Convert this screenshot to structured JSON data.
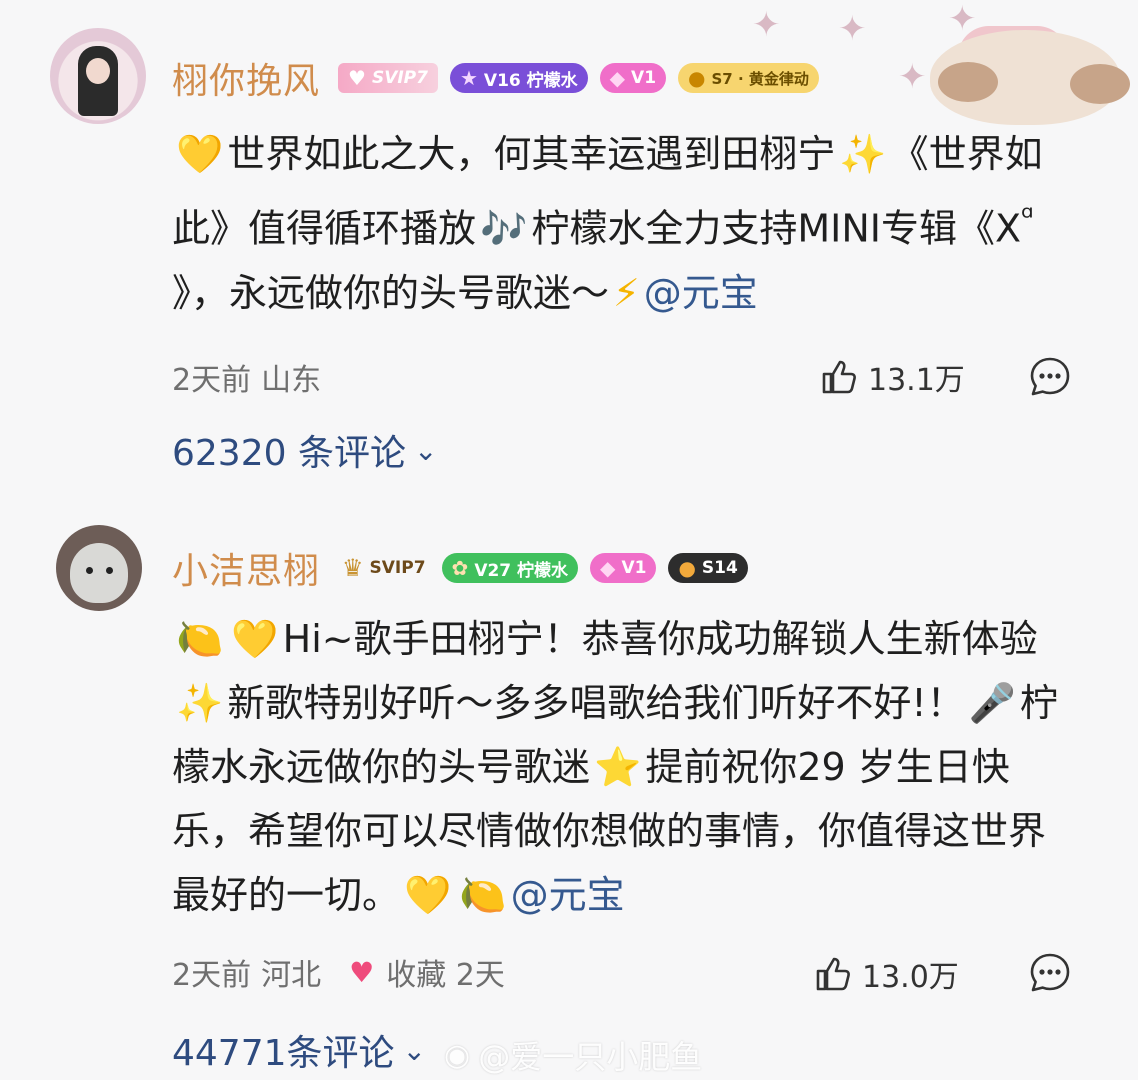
{
  "comments": [
    {
      "username": "栩你挽风",
      "badges": [
        "SVIP7",
        "V16 柠檬水",
        "V1",
        "S7 · 黄金律动"
      ],
      "content_parts": [
        "💛",
        "世界如此之大，何其幸运遇到田栩宁",
        "✨",
        "《世界如此》值得循环播放",
        "🎶",
        "柠檬水全力支持MINI专辑《X",
        "ᵅ",
        " 》，永远做你的头号歌迷～",
        "⚡",
        "@元宝"
      ],
      "time": "2天前",
      "location": "山东",
      "likes": "13.1万",
      "replies_label": "62320 条评论",
      "favorite_label": ""
    },
    {
      "username": "小洁思栩",
      "badges": [
        "SVIP7",
        "V27 柠檬水",
        "V1",
        "S14"
      ],
      "content_parts": [
        "🍋",
        "💛",
        "Hi~歌手田栩宁！恭喜你成功解锁人生新体验",
        "✨",
        "新歌特别好听～多多唱歌给我们听好不好!！",
        "🎤",
        "柠檬水永远做你的头号歌迷",
        "⭐",
        "提前祝你29 岁生日快乐，希望你可以尽情做你想做的事情，你值得这世界最好的一切。",
        "💛",
        "🍋",
        "@元宝"
      ],
      "time": "2天前",
      "location": "河北",
      "likes": "13.0万",
      "replies_label": "44771条评论",
      "favorite_label": "收藏 2天"
    }
  ],
  "watermark": "@爱一只小肥鱼",
  "icons": {
    "like": "thumb-up-icon",
    "reply": "comment-bubble-icon",
    "chevron": "chevron-down-icon",
    "favorite": "heart-icon",
    "watermark": "weibo-icon"
  },
  "colors": {
    "username": "#d08c4c",
    "mention": "#35598f",
    "replies": "#2e4b7f",
    "meta": "#6f6f6f"
  }
}
